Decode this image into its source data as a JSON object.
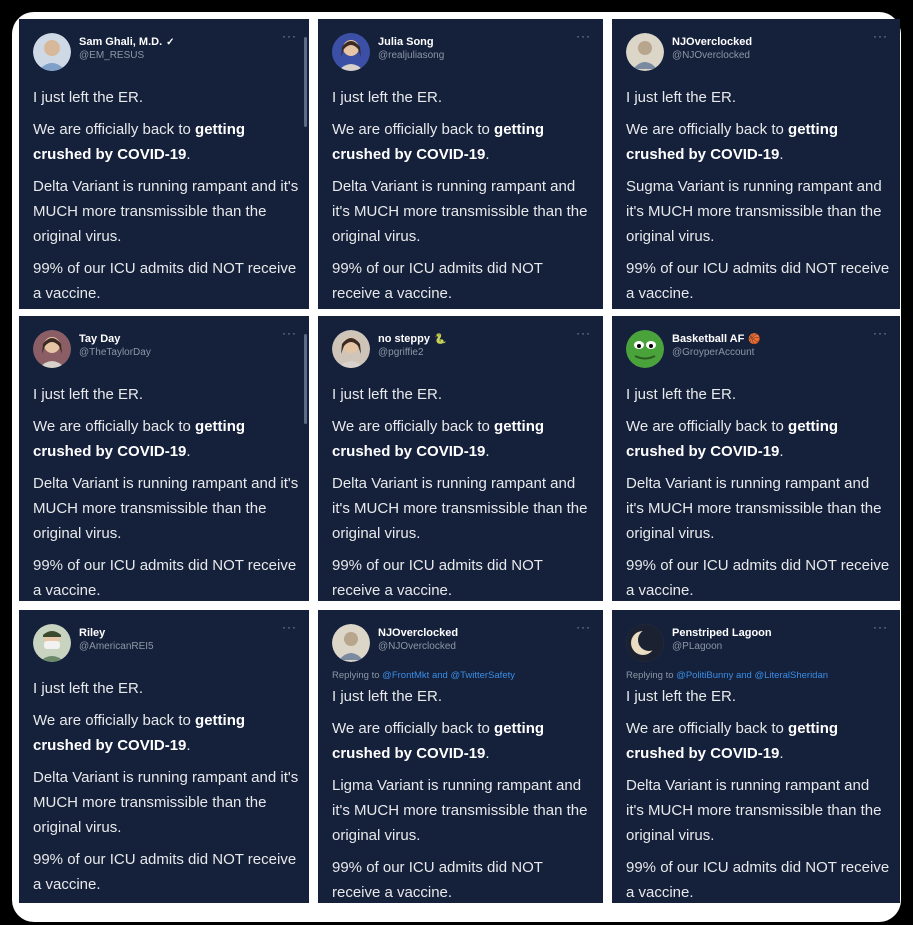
{
  "tweets": [
    {
      "name": "Sam Ghali, M.D.",
      "handle": "@EM_RESUS",
      "verified": true,
      "badge": "✓",
      "variant": "Delta",
      "avatar": "doctor-avatar",
      "avatar_color": "#7fa0c8"
    },
    {
      "name": "Julia Song",
      "handle": "@realjuliasong",
      "verified": false,
      "badge": "",
      "variant": "Delta",
      "avatar": "woman-avatar",
      "avatar_color": "#3a4fa5"
    },
    {
      "name": "NJOverclocked",
      "handle": "@NJOverclocked",
      "verified": false,
      "badge": "",
      "variant": "Sugma",
      "avatar": "character-avatar",
      "avatar_color": "#b7a58c"
    },
    {
      "name": "Tay Day",
      "handle": "@TheTaylorDay",
      "verified": false,
      "badge": "",
      "variant": "Delta",
      "avatar": "woman-avatar",
      "avatar_color": "#8a5e64"
    },
    {
      "name": "no steppy",
      "handle": "@pgriffie2",
      "verified": false,
      "badge": "🐍",
      "variant": "Delta",
      "avatar": "woman-avatar",
      "avatar_color": "#cfc4b8"
    },
    {
      "name": "Basketball AF",
      "handle": "@GroyperAccount",
      "verified": false,
      "badge": "🏀",
      "variant": "Delta",
      "avatar": "frog-avatar",
      "avatar_color": "#4aa33a"
    },
    {
      "name": "Riley",
      "handle": "@AmericanREI5",
      "verified": false,
      "badge": "",
      "variant": "Delta",
      "avatar": "masked-avatar",
      "avatar_color": "#6b8a6a"
    },
    {
      "name": "NJOverclocked",
      "handle": "@NJOverclocked",
      "verified": false,
      "badge": "",
      "variant": "Ligma",
      "avatar": "character-avatar",
      "avatar_color": "#b7a58c",
      "reply_prefix": "Replying to",
      "reply_a": "@FrontMkt",
      "reply_and": "and",
      "reply_b": "@TwitterSafety"
    },
    {
      "name": "Penstriped Lagoon",
      "handle": "@PLagoon",
      "verified": false,
      "badge": "",
      "variant": "Delta",
      "avatar": "moon-avatar",
      "avatar_color": "#1b2130",
      "reply_prefix": "Replying to",
      "reply_a": "@PolitiBunny",
      "reply_and": "and",
      "reply_b": "@LiteralSheridan"
    }
  ],
  "body": {
    "line1": "I just left the ER.",
    "line2_pre": "We are officially back to ",
    "line2_bold": "getting crushed by COVID-19",
    "line2_post": ".",
    "line3_suffix": " Variant is running rampant and it's MUCH more transmissible than the original virus.",
    "line4": "99% of our ICU admits did NOT receive a vaccine."
  },
  "more_icon": "more-options-icon",
  "colors": {
    "card_bg": "#15203b",
    "page_bg": "#000000",
    "frame_bg": "#ffffff",
    "mention": "#3a8ee6",
    "muted": "#8b98a5"
  }
}
